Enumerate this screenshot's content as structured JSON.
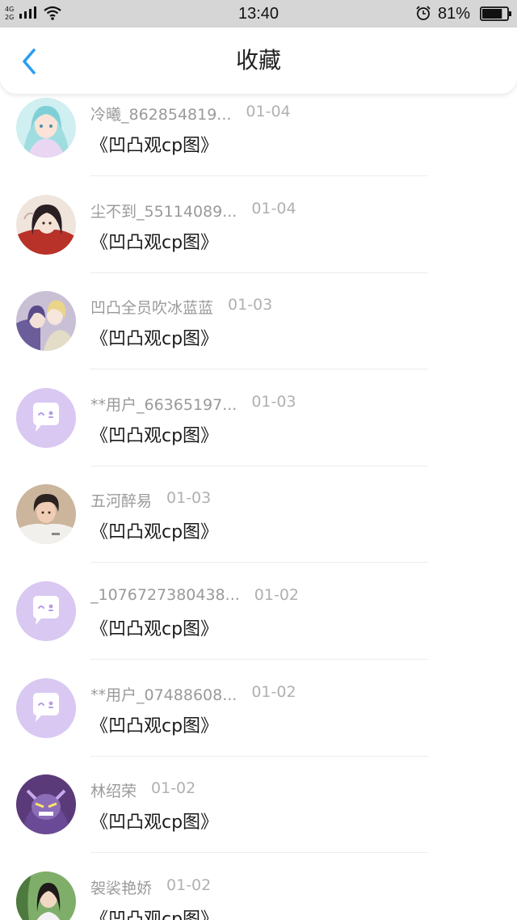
{
  "status_bar": {
    "network_top": "4G",
    "network_bottom": "2G",
    "time": "13:40",
    "battery_pct": "81%",
    "battery_level": 0.81
  },
  "header": {
    "title": "收藏",
    "accent_color": "#2a9df4"
  },
  "items": [
    {
      "name": "冷曦_862854819...",
      "date": "01-04",
      "title": "《凹凸观cp图》",
      "avatar": "anime-girl-avatar"
    },
    {
      "name": "尘不到_55114089...",
      "date": "01-04",
      "title": "《凹凸观cp图》",
      "avatar": "anime-boy-avatar"
    },
    {
      "name": "凹凸全员吹冰蓝蓝",
      "date": "01-03",
      "title": "《凹凸观cp图》",
      "avatar": "anime-couple-avatar"
    },
    {
      "name": "**用户_66365197...",
      "date": "01-03",
      "title": "《凹凸观cp图》",
      "avatar": "default-chat-avatar"
    },
    {
      "name": "五河醉易",
      "date": "01-03",
      "title": "《凹凸观cp图》",
      "avatar": "photo-boy-avatar"
    },
    {
      "name": "_1076727380438...",
      "date": "01-02",
      "title": "《凹凸观cp图》",
      "avatar": "default-chat-avatar"
    },
    {
      "name": "**用户_07488608...",
      "date": "01-02",
      "title": "《凹凸观cp图》",
      "avatar": "default-chat-avatar"
    },
    {
      "name": "林绍荣",
      "date": "01-02",
      "title": "《凹凸观cp图》",
      "avatar": "cartoon-villain-avatar"
    },
    {
      "name": "袈裟艳娇",
      "date": "01-02",
      "title": "《凹凸观cp图》",
      "avatar": "photo-girl-avatar"
    }
  ]
}
